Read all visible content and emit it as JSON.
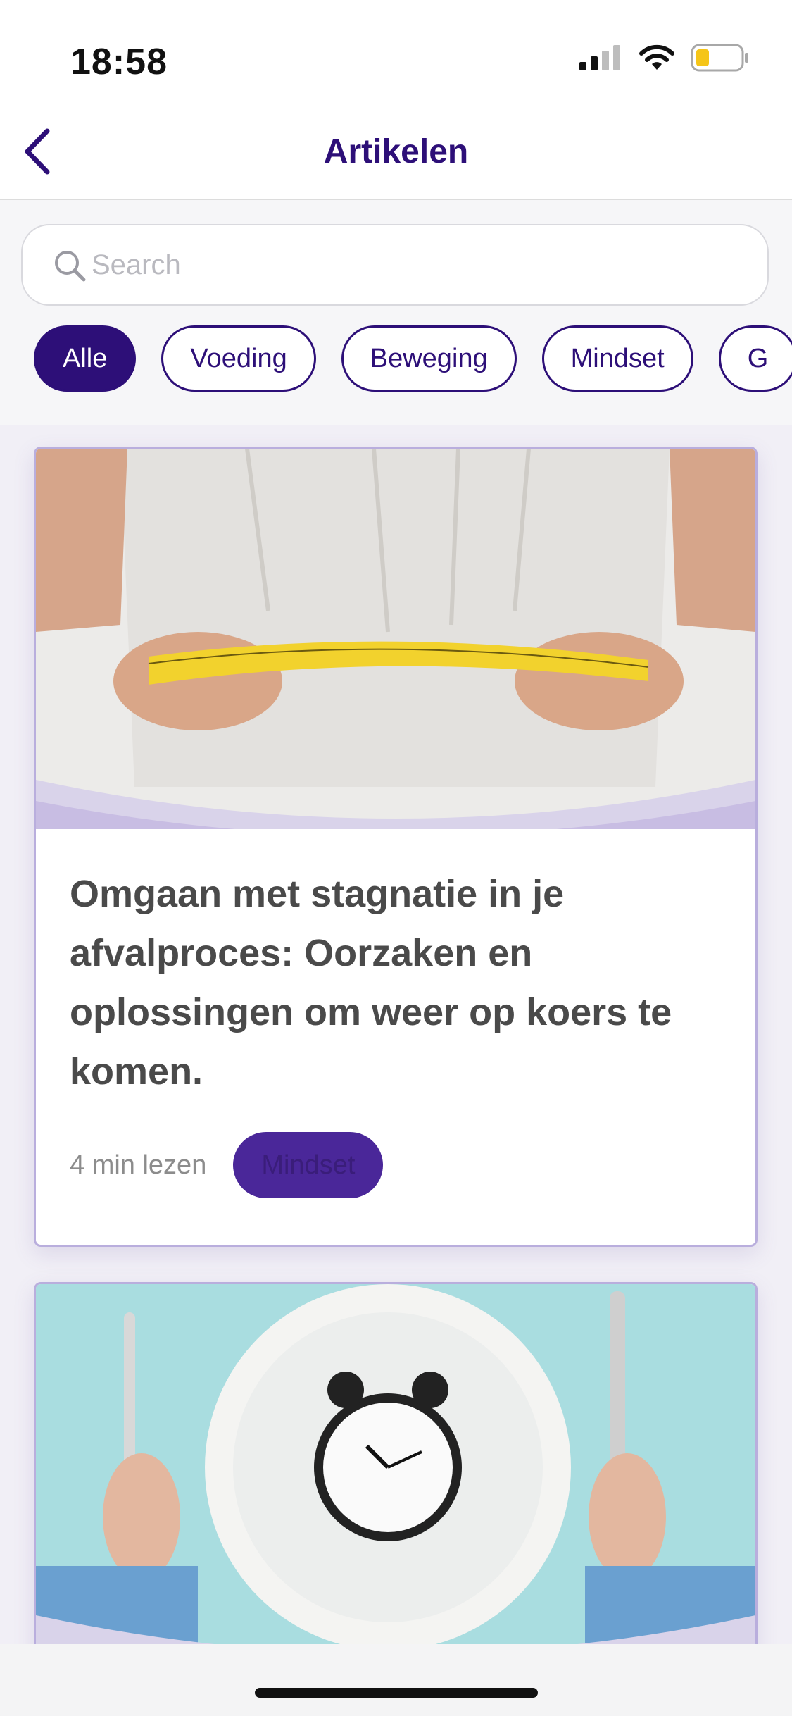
{
  "status_bar": {
    "time": "18:58"
  },
  "header": {
    "title": "Artikelen"
  },
  "search": {
    "placeholder": "Search"
  },
  "filters": [
    {
      "label": "Alle",
      "active": true
    },
    {
      "label": "Voeding",
      "active": false
    },
    {
      "label": "Beweging",
      "active": false
    },
    {
      "label": "Mindset",
      "active": false
    },
    {
      "label": "G",
      "active": false
    }
  ],
  "articles": [
    {
      "title": "Omgaan met stagnatie in je afvalproces: Oorzaken en oplossingen om weer op koers te komen.",
      "read_time": "4 min lezen",
      "tag": "Mindset",
      "image": "measuring-tape-waist-image"
    },
    {
      "image": "clock-on-plate-image"
    }
  ],
  "colors": {
    "brand": "#2d0f78",
    "tag_bg": "#4a2799",
    "card_border": "#b9aedd",
    "feed_bg": "#f1eff6"
  }
}
